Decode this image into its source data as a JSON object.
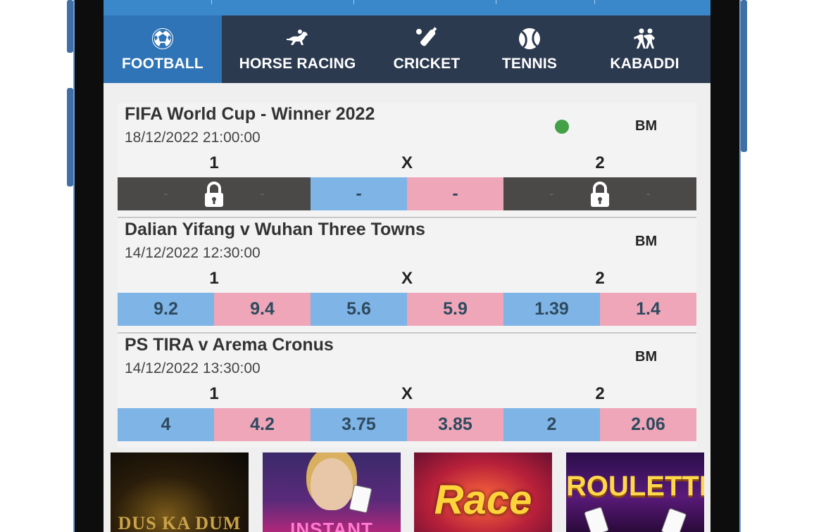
{
  "sport_tabs": [
    {
      "label": "FOOTBALL",
      "icon": "football-icon",
      "active": true
    },
    {
      "label": "HORSE RACING",
      "icon": "horse-racing-icon",
      "active": false
    },
    {
      "label": "CRICKET",
      "icon": "cricket-bat-icon",
      "active": false
    },
    {
      "label": "TENNIS",
      "icon": "tennis-ball-icon",
      "active": false
    },
    {
      "label": "KABADDI",
      "icon": "kabaddi-icon",
      "active": false
    }
  ],
  "odds_headers": {
    "home": "1",
    "draw": "X",
    "away": "2"
  },
  "events": [
    {
      "title": "FIFA World Cup - Winner 2022",
      "datetime": "18/12/2022 21:00:00",
      "live": true,
      "market_tag": "BM",
      "home": {
        "suspended": true,
        "back": "-",
        "lay": "-"
      },
      "draw": {
        "suspended": false,
        "back": "-",
        "lay": "-"
      },
      "away": {
        "suspended": true,
        "back": "-",
        "lay": "-"
      }
    },
    {
      "title": "Dalian Yifang v Wuhan Three Towns",
      "datetime": "14/12/2022 12:30:00",
      "live": false,
      "market_tag": "BM",
      "home": {
        "suspended": false,
        "back": "9.2",
        "lay": "9.4"
      },
      "draw": {
        "suspended": false,
        "back": "5.6",
        "lay": "5.9"
      },
      "away": {
        "suspended": false,
        "back": "1.39",
        "lay": "1.4"
      }
    },
    {
      "title": "PS TIRA v Arema Cronus",
      "datetime": "14/12/2022 13:30:00",
      "live": false,
      "market_tag": "BM",
      "home": {
        "suspended": false,
        "back": "4",
        "lay": "4.2"
      },
      "draw": {
        "suspended": false,
        "back": "3.75",
        "lay": "3.85"
      },
      "away": {
        "suspended": false,
        "back": "2",
        "lay": "2.06"
      }
    }
  ],
  "casino_games": [
    {
      "title": "DUS KA DUM",
      "icon": "dus-ka-dum-thumbnail"
    },
    {
      "title": "INSTANT",
      "icon": "instant-game-thumbnail"
    },
    {
      "title": "Race",
      "icon": "race-to-2nd-thumbnail"
    },
    {
      "title": "ROULETTE",
      "icon": "roulette-thumbnail"
    }
  ],
  "colors": {
    "tab_bar": "#2c3a4f",
    "tab_active": "#2f74b6",
    "back_odds": "#7fb4e6",
    "lay_odds": "#eea6b8",
    "suspended": "#4b4848",
    "live_dot": "#43a047"
  }
}
